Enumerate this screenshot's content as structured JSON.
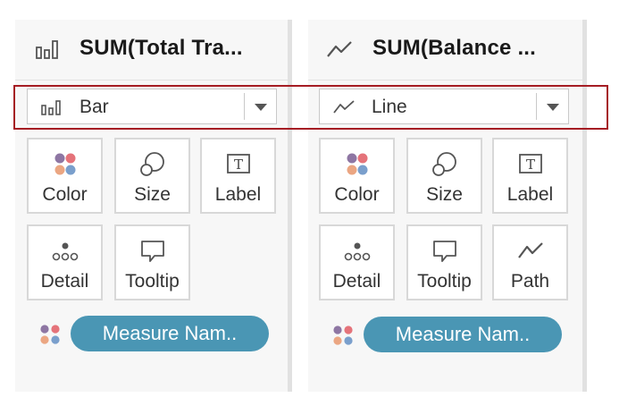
{
  "left_card": {
    "title": "SUM(Total Tra...",
    "header_icon": "bar-chart-icon",
    "mark_type": {
      "label": "Bar",
      "icon": "bar-chart-icon"
    },
    "tiles": [
      {
        "label": "Color",
        "icon": "color-dots-icon"
      },
      {
        "label": "Size",
        "icon": "size-circles-icon"
      },
      {
        "label": "Label",
        "icon": "text-label-icon"
      },
      {
        "label": "Detail",
        "icon": "detail-dots-icon"
      },
      {
        "label": "Tooltip",
        "icon": "tooltip-bubble-icon"
      }
    ],
    "color_field_pill": "Measure Nam.."
  },
  "right_card": {
    "title": "SUM(Balance ...",
    "header_icon": "line-chart-icon",
    "mark_type": {
      "label": "Line",
      "icon": "line-chart-icon"
    },
    "tiles": [
      {
        "label": "Color",
        "icon": "color-dots-icon"
      },
      {
        "label": "Size",
        "icon": "size-circles-icon"
      },
      {
        "label": "Label",
        "icon": "text-label-icon"
      },
      {
        "label": "Detail",
        "icon": "detail-dots-icon"
      },
      {
        "label": "Tooltip",
        "icon": "tooltip-bubble-icon"
      },
      {
        "label": "Path",
        "icon": "path-line-icon"
      }
    ],
    "color_field_pill": "Measure Nam.."
  },
  "colors": {
    "highlight": "#a51d24",
    "pill": "#4a96b4",
    "dot_purple": "#8e76a3",
    "dot_red": "#e5737a",
    "dot_orange": "#eba682",
    "dot_blue": "#7a9fcc"
  }
}
